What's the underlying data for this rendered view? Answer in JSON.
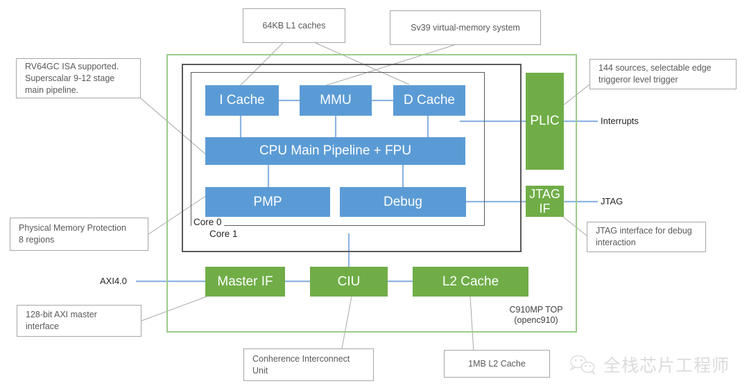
{
  "diagram": {
    "title": "C910MP TOP (openc910) block diagram",
    "colors": {
      "blue_block": "#5B9BD5",
      "green_block": "#70AD47",
      "chip_outline": "#9CCB8B",
      "core_outline": "#595959",
      "wire": "#8EB4E3",
      "leader_line": "#A6A6A6",
      "callout_border": "#A6A6A6",
      "callout_text": "#595959"
    },
    "chip": {
      "label": "C910MP TOP\n(openc910)"
    },
    "cores": [
      {
        "name": "core-0",
        "label": "Core 0"
      },
      {
        "name": "core-1",
        "label": "Core 1"
      }
    ],
    "blocks": {
      "i_cache": "I Cache",
      "mmu": "MMU",
      "d_cache": "D Cache",
      "cpu_pipeline": "CPU Main Pipeline + FPU",
      "pmp": "PMP",
      "debug": "Debug",
      "plic": "PLIC",
      "jtag_if": "JTAG\nIF",
      "master_if": "Master IF",
      "ciu": "CIU",
      "l2_cache": "L2 Cache"
    },
    "ports": {
      "interrupts": "Interrupts",
      "jtag": "JTAG",
      "axi": "AXI4.0"
    },
    "callouts": {
      "l1_caches": "64KB L1 caches",
      "sv39": "Sv39 virtual-memory system",
      "isa": "RV64GC ISA supported.\nSuperscalar 9-12 stage\nmain pipeline.",
      "plic_sources": "144 sources,  selectable edge\ntriggeror level trigger",
      "pmp": "Physical Memory Protection\n8 regions",
      "jtag_debug": "JTAG interface for debug\ninteraction",
      "axi_master": "128-bit AXI master\ninterface",
      "ciu": "Conherence Interconnect\nUnit",
      "l2_cache": "1MB L2 Cache"
    },
    "watermark": {
      "text": "全栈芯片工程师",
      "icon": "wechat-icon"
    }
  }
}
